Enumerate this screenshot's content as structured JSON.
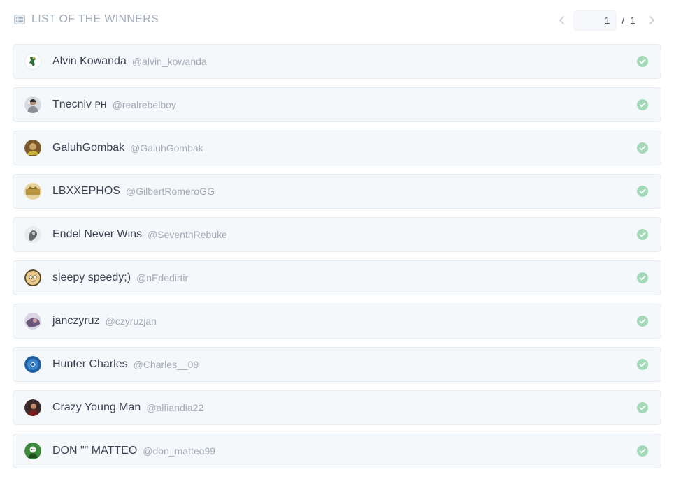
{
  "header": {
    "title": "LIST OF THE WINNERS",
    "title_icon": "list-icon"
  },
  "pagination": {
    "prev_icon": "chevron-left-icon",
    "next_icon": "chevron-right-icon",
    "current_page": "1",
    "separator": "/",
    "total_pages": "1"
  },
  "colors": {
    "check": "#9fd5b4",
    "row_bg": "#f5f8fb",
    "title": "#a3adbb"
  },
  "winners": [
    {
      "name": "Alvin Kowanda",
      "handle": "@alvin_kowanda",
      "avatar_icon": "avatar-image",
      "avatar_color": "#2f6b3a"
    },
    {
      "name": "Tnecniv ᴘʜ",
      "handle": "@realrebelboy",
      "avatar_icon": "avatar-image",
      "avatar_color": "#8c8f96"
    },
    {
      "name": "GaluhGombak",
      "handle": "@GaluhGombak",
      "avatar_icon": "avatar-image",
      "avatar_color": "#7a5a2a"
    },
    {
      "name": "LBXXEPHOS",
      "handle": "@GilbertRomeroGG",
      "avatar_icon": "avatar-image",
      "avatar_color": "#b8943e"
    },
    {
      "name": "Endel Never Wins",
      "handle": "@SeventhRebuke",
      "avatar_icon": "avatar-image",
      "avatar_color": "#6a6a6a"
    },
    {
      "name": "sleepy speedy;)",
      "handle": "@nEdedirtir",
      "avatar_icon": "avatar-image",
      "avatar_color": "#c8a46c"
    },
    {
      "name": "janczyruz",
      "handle": "@czyruzjan",
      "avatar_icon": "avatar-image",
      "avatar_color": "#6d5a7a"
    },
    {
      "name": "Hunter Charles",
      "handle": "@Charles__09",
      "avatar_icon": "avatar-image",
      "avatar_color": "#1f5fa0"
    },
    {
      "name": "Crazy Young Man",
      "handle": "@alfiandia22",
      "avatar_icon": "avatar-image",
      "avatar_color": "#3a2a2a"
    },
    {
      "name": "DON \"\" MATTEO",
      "handle": "@don_matteo99",
      "avatar_icon": "avatar-image",
      "avatar_color": "#3d8a3d"
    }
  ]
}
